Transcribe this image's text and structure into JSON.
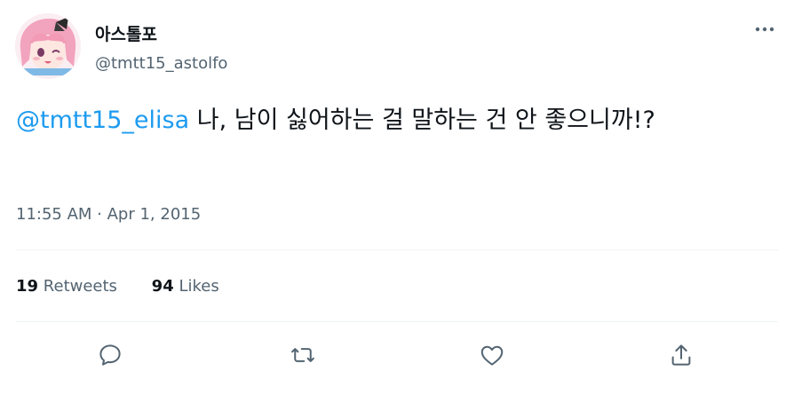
{
  "author": {
    "display_name": "아스톨포",
    "handle": "@tmtt15_astolfo",
    "avatar_icon": "profile-avatar"
  },
  "tweet": {
    "mention": "@tmtt15_elisa",
    "text": " 나, 남이 싫어하는 걸 말하는 건 안 좋으니까!?",
    "timestamp": "11:55 AM · Apr 1, 2015"
  },
  "stats": {
    "retweets_count": "19",
    "retweets_label": "Retweets",
    "likes_count": "94",
    "likes_label": "Likes"
  },
  "actions": [
    "reply-icon",
    "retweet-icon",
    "like-icon",
    "share-icon"
  ],
  "colors": {
    "link": "#1d9bf0",
    "secondary_text": "#536471",
    "primary_text": "#0f1419",
    "divider": "#eff3f4"
  }
}
